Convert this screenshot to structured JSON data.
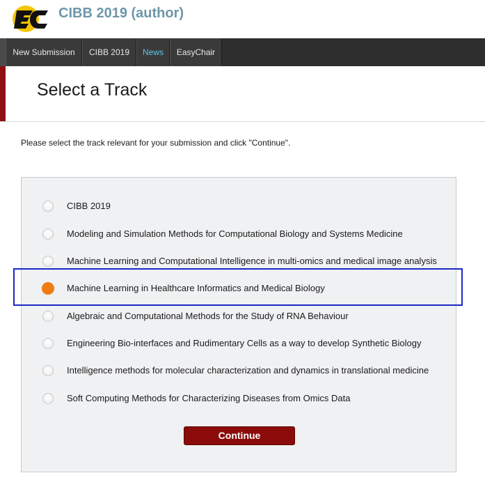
{
  "header": {
    "logo_icon": "easychair-logo-icon",
    "title": "CIBB 2019 (author)",
    "title_color": "#6d97aa"
  },
  "nav": {
    "items": [
      {
        "label": "New Submission",
        "active": false
      },
      {
        "label": "CIBB 2019",
        "active": false
      },
      {
        "label": "News",
        "active": true
      },
      {
        "label": "EasyChair",
        "active": false
      }
    ]
  },
  "page": {
    "title": "Select a Track",
    "accent_color": "#8e1014",
    "instructions": "Please select the track relevant for your submission and click \"Continue\"."
  },
  "tracks": {
    "selected_index": 3,
    "items": [
      {
        "label": "CIBB 2019",
        "selected": false
      },
      {
        "label": "Modeling and Simulation Methods for Computational Biology and Systems Medicine",
        "selected": false
      },
      {
        "label": "Machine Learning and Computational Intelligence in multi-omics and medical image analysis",
        "selected": false
      },
      {
        "label": "Machine Learning in Healthcare Informatics and Medical Biology",
        "selected": true
      },
      {
        "label": "Algebraic and Computational Methods for the Study of RNA Behaviour",
        "selected": false
      },
      {
        "label": "Engineering Bio-interfaces and Rudimentary Cells as a way to develop Synthetic Biology",
        "selected": false
      },
      {
        "label": "Intelligence methods for molecular characterization and dynamics in translational medicine",
        "selected": false
      },
      {
        "label": "Soft Computing Methods for Characterizing Diseases from Omics Data",
        "selected": false
      }
    ]
  },
  "actions": {
    "continue_label": "Continue",
    "continue_color": "#8b0b0b"
  },
  "colors": {
    "selected_radio": "#f07b12",
    "highlight_border": "#1b27c7",
    "nav_background": "#2e2e2e",
    "nav_active_text": "#5fc3e4"
  }
}
